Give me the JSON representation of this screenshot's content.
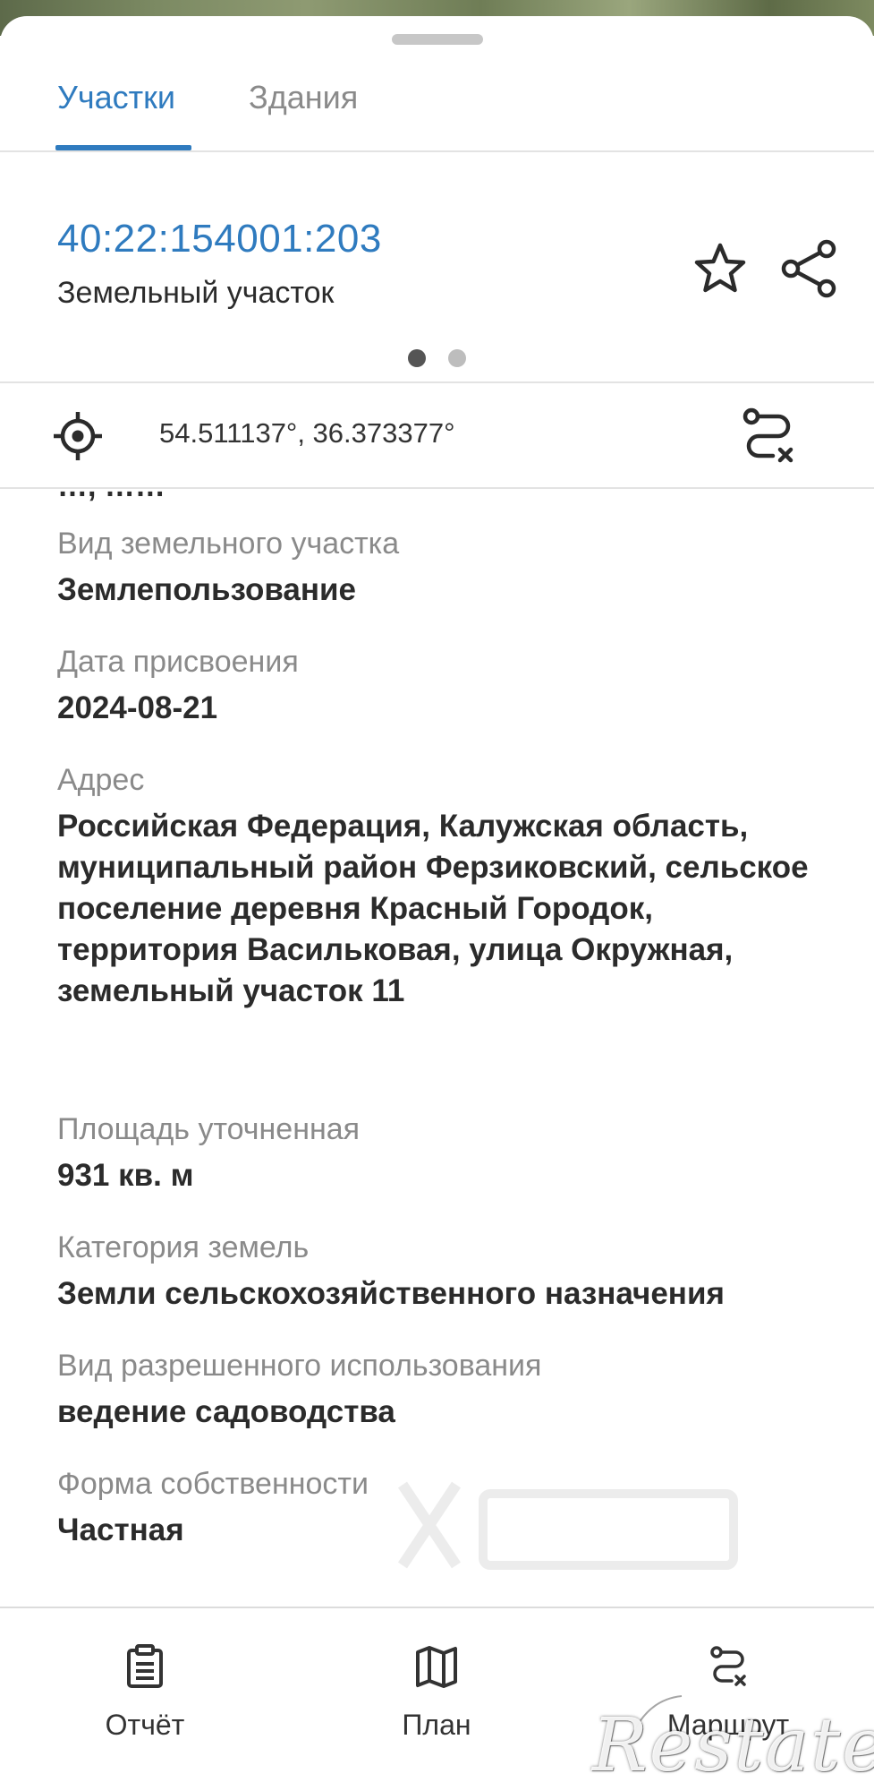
{
  "tabs": [
    {
      "label": "Участки",
      "active": true
    },
    {
      "label": "Здания",
      "active": false
    }
  ],
  "object": {
    "cadastral_number": "40:22:154001:203",
    "type": "Земельный участок"
  },
  "carousel": {
    "page": 1,
    "total": 2
  },
  "location": {
    "coordinates": "54.511137°, 36.373377°"
  },
  "details": {
    "cut_off_text": "…, ……",
    "fields": [
      {
        "label": "Вид земельного участка",
        "value": "Землепользование"
      },
      {
        "label": "Дата присвоения",
        "value": "2024-08-21"
      },
      {
        "label": "Адрес",
        "value": "Российская Федерация, Калужская область, муниципальный район Ферзиковский, сельское поселение деревня Красный Городок, территория Васильковая, улица Окружная, земельный участок 11"
      },
      {
        "label": "Площадь уточненная",
        "value": "931 кв. м"
      },
      {
        "label": "Категория земель",
        "value": "Земли сельскохозяйственного назначения"
      },
      {
        "label": "Вид разрешенного использования",
        "value": "ведение садоводства"
      },
      {
        "label": "Форма собственности",
        "value": "Частная"
      }
    ]
  },
  "bottom_nav": [
    {
      "label": "Отчёт",
      "icon": "clipboard-icon"
    },
    {
      "label": "План",
      "icon": "map-icon"
    },
    {
      "label": "Маршрут",
      "icon": "route-icon"
    }
  ],
  "watermark": {
    "text": "Restate"
  },
  "colors": {
    "accent": "#2f7bbf",
    "label_gray": "#8a8a8a",
    "text": "#2b2b2b",
    "divider": "#e3e3e3"
  }
}
